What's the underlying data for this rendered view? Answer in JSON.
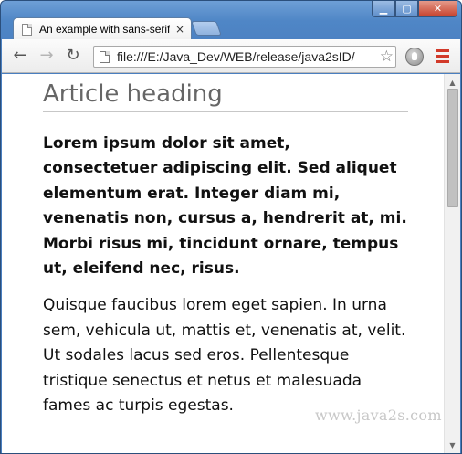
{
  "browser": {
    "tab": {
      "title": "An example with sans-serif",
      "close_glyph": "×",
      "favicon": "page-icon"
    },
    "window_controls": {
      "minimize": "▁",
      "maximize": "▢",
      "close": "✕"
    },
    "toolbar": {
      "back_icon": "←",
      "forward_icon": "→",
      "reload_icon": "↻",
      "url": "file:///E:/Java_Dev/WEB/release/java2sID/",
      "star_icon": "☆",
      "menu_color": "#d23a2a"
    }
  },
  "page": {
    "heading": "Article heading",
    "lead": "Lorem ipsum dolor sit amet, consectetuer adipiscing elit. Sed aliquet elementum erat. Integer diam mi, venenatis non, cursus a, hendrerit at, mi. Morbi risus mi, tincidunt ornare, tempus ut, eleifend nec, risus.",
    "paragraph": "Quisque faucibus lorem eget sapien. In urna sem, vehicula ut, mattis et, venenatis at, velit. Ut sodales lacus sed eros. Pellentesque tristique senectus et netus et malesuada fames ac turpis egestas.",
    "watermark": "www.java2s.com"
  },
  "scrollbar": {
    "up_glyph": "▲",
    "down_glyph": "▼",
    "position_fraction": 0.0
  }
}
